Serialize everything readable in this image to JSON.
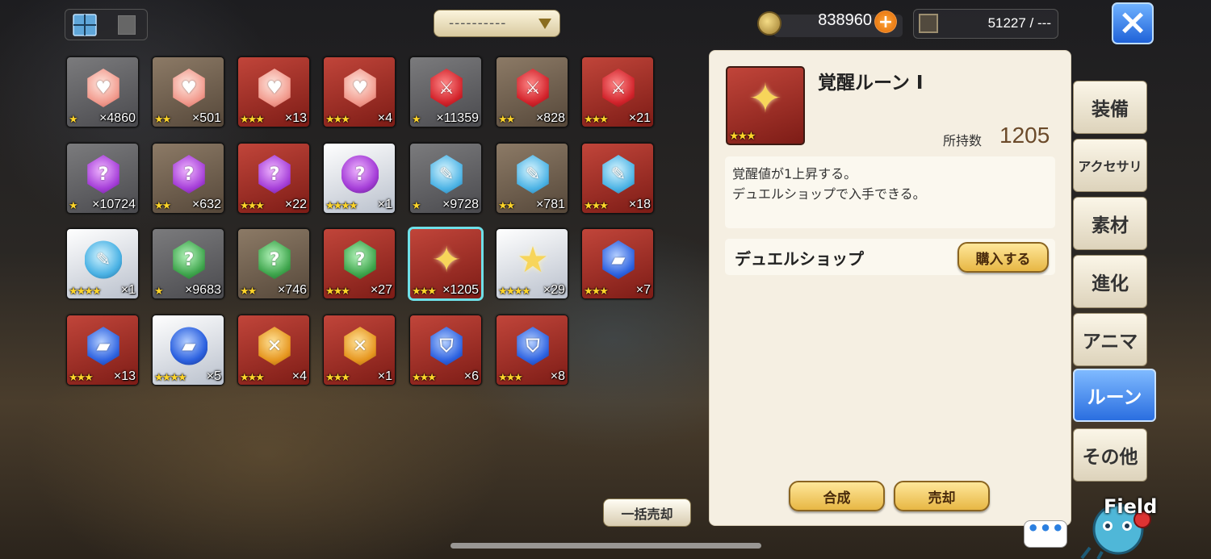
{
  "topbar": {
    "sort_label": "----------",
    "gold": "838960",
    "plus": "+",
    "stones": "51227 / ---",
    "close": "×"
  },
  "items": [
    {
      "bg": "gray",
      "gem": "pink",
      "sym": "♥",
      "stars": "★",
      "count": "×4860"
    },
    {
      "bg": "brown",
      "gem": "pink",
      "sym": "♥",
      "stars": "★★",
      "count": "×501"
    },
    {
      "bg": "red",
      "gem": "pink",
      "sym": "♥",
      "stars": "★★★",
      "count": "×13"
    },
    {
      "bg": "red",
      "gem": "pink",
      "sym": "♥",
      "stars": "★★★",
      "count": "×4"
    },
    {
      "bg": "gray",
      "gem": "red",
      "sym": "⚔",
      "stars": "★",
      "count": "×11359"
    },
    {
      "bg": "brown",
      "gem": "red",
      "sym": "⚔",
      "stars": "★★",
      "count": "×828"
    },
    {
      "bg": "red",
      "gem": "red",
      "sym": "⚔",
      "stars": "★★★",
      "count": "×21"
    },
    {
      "bg": "gray",
      "gem": "purple",
      "sym": "?",
      "stars": "★",
      "count": "×10724"
    },
    {
      "bg": "brown",
      "gem": "purple",
      "sym": "?",
      "stars": "★★",
      "count": "×632"
    },
    {
      "bg": "red",
      "gem": "purple",
      "sym": "?",
      "stars": "★★★",
      "count": "×22"
    },
    {
      "bg": "white",
      "gem": "purple",
      "sym": "?",
      "stars": "★★★★",
      "count": "×1",
      "round": true
    },
    {
      "bg": "gray",
      "gem": "cyan",
      "sym": "✎",
      "stars": "★",
      "count": "×9728"
    },
    {
      "bg": "brown",
      "gem": "cyan",
      "sym": "✎",
      "stars": "★★",
      "count": "×781"
    },
    {
      "bg": "red",
      "gem": "cyan",
      "sym": "✎",
      "stars": "★★★",
      "count": "×18"
    },
    {
      "bg": "white",
      "gem": "cyan",
      "sym": "✎",
      "stars": "★★★★",
      "count": "×1",
      "round": true
    },
    {
      "bg": "gray",
      "gem": "green",
      "sym": "?",
      "stars": "★",
      "count": "×9683"
    },
    {
      "bg": "brown",
      "gem": "green",
      "sym": "?",
      "stars": "★★",
      "count": "×746"
    },
    {
      "bg": "red",
      "gem": "green",
      "sym": "?",
      "stars": "★★★",
      "count": "×27"
    },
    {
      "bg": "red",
      "gem": "gold",
      "sym": "✦",
      "stars": "★★★",
      "count": "×1205",
      "selected": true
    },
    {
      "bg": "white",
      "gem": "gold",
      "sym": "★",
      "stars": "★★★★",
      "count": "×29"
    },
    {
      "bg": "red",
      "gem": "blue",
      "sym": "▰",
      "stars": "★★★",
      "count": "×7"
    },
    {
      "bg": "red",
      "gem": "blue",
      "sym": "▰",
      "stars": "★★★",
      "count": "×13"
    },
    {
      "bg": "white",
      "gem": "blue",
      "sym": "▰",
      "stars": "★★★★",
      "count": "×5",
      "round": true
    },
    {
      "bg": "red",
      "gem": "orange",
      "sym": "✕",
      "stars": "★★★",
      "count": "×4"
    },
    {
      "bg": "red",
      "gem": "orange",
      "sym": "✕",
      "stars": "★★★",
      "count": "×1"
    },
    {
      "bg": "red",
      "gem": "blue",
      "sym": "⛉",
      "stars": "★★★",
      "count": "×6"
    },
    {
      "bg": "red",
      "gem": "blue",
      "sym": "⛉",
      "stars": "★★★",
      "count": "×8"
    }
  ],
  "detail": {
    "name": "覚醒ルーン I",
    "stars": "★★★",
    "icon_sym": "✦",
    "own_label": "所持数",
    "own_count": "1205",
    "desc_line1": "覚醒値が1上昇する。",
    "desc_line2": "デュエルショップで入手できる。",
    "shop_name": "デュエルショップ",
    "buy_label": "購入する",
    "combine_label": "合成",
    "sell_label": "売却"
  },
  "bulk_sell_label": "一括売却",
  "tabs": [
    {
      "label": "装備"
    },
    {
      "label": "アクセサリ"
    },
    {
      "label": "素材"
    },
    {
      "label": "進化"
    },
    {
      "label": "アニマ"
    },
    {
      "label": "ルーン",
      "active": true
    },
    {
      "label": "その他"
    }
  ],
  "field_label": "Field",
  "chat_label": "•••"
}
